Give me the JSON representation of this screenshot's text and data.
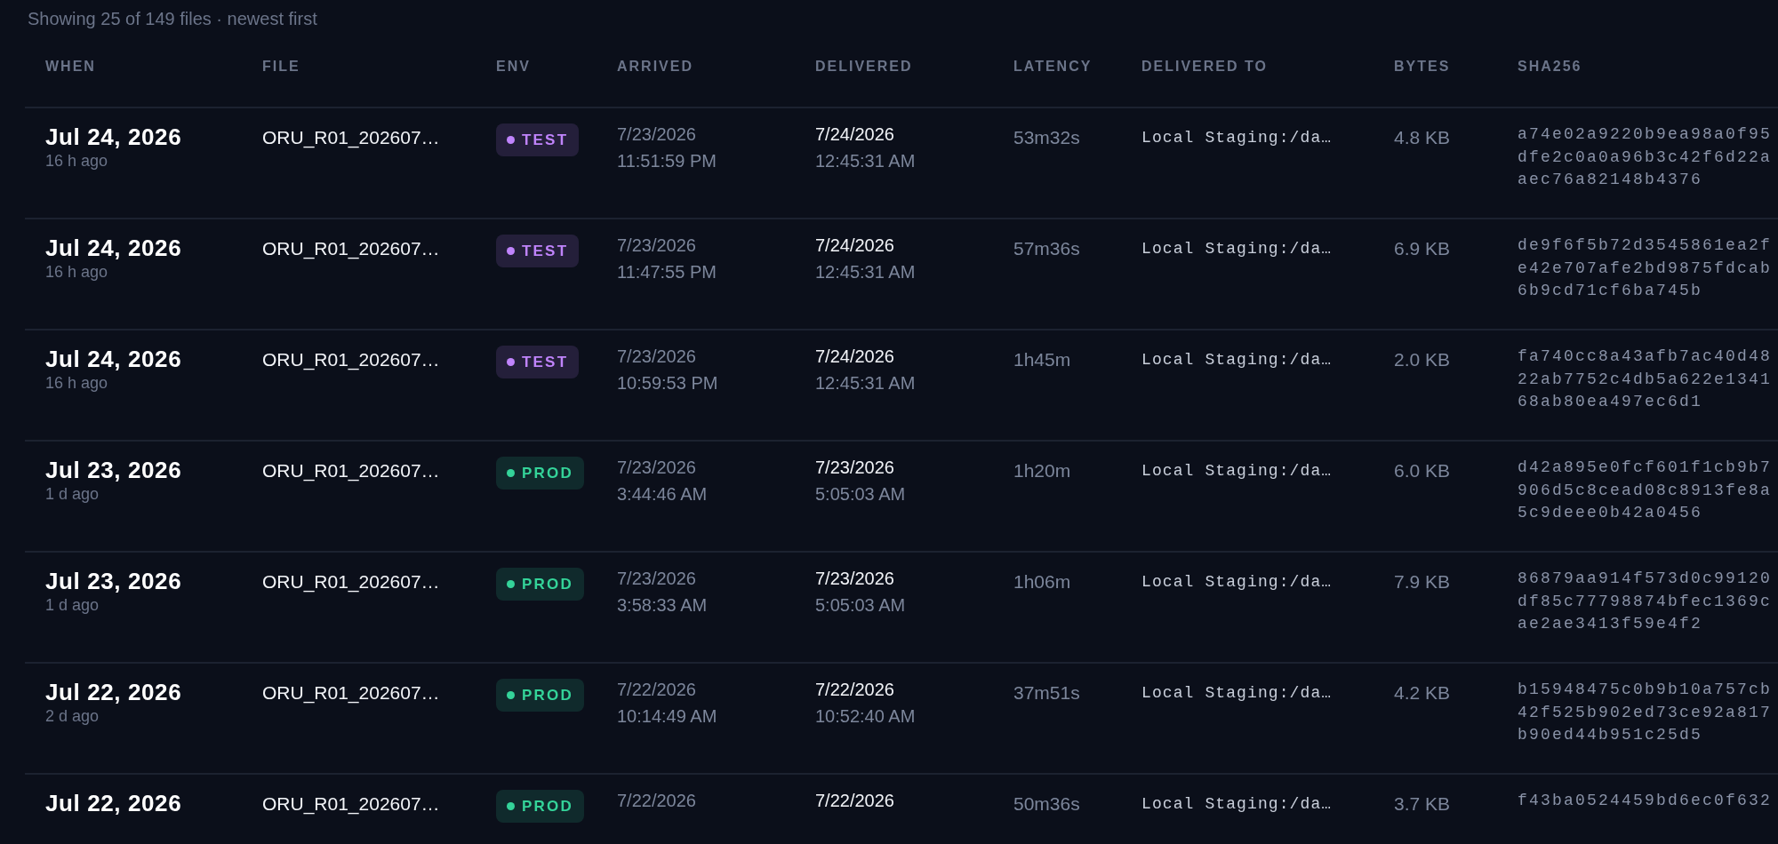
{
  "summary": "Showing 25 of 149 files · newest first",
  "columns": [
    "WHEN",
    "FILE",
    "ENV",
    "ARRIVED",
    "DELIVERED",
    "LATENCY",
    "DELIVERED TO",
    "BYTES",
    "SHA256"
  ],
  "rows": [
    {
      "when": "Jul 24, 2026",
      "ago": "16 h ago",
      "file": "ORU_R01_202607…",
      "env": {
        "label": "TEST",
        "color": "#c084fc"
      },
      "arrived": [
        "7/23/2026",
        "11:51:59 PM"
      ],
      "delivered": [
        "7/24/2026",
        "12:45:31 AM"
      ],
      "latency": "53m32s",
      "delivered_to": "Local Staging:/da…",
      "bytes": "4.8 KB",
      "sha256": [
        "a74e02a9220b9ea98a0f95",
        "dfe2c0a0a96b3c42f6d22a",
        "aec76a82148b4376"
      ]
    },
    {
      "when": "Jul 24, 2026",
      "ago": "16 h ago",
      "file": "ORU_R01_202607…",
      "env": {
        "label": "TEST",
        "color": "#c084fc"
      },
      "arrived": [
        "7/23/2026",
        "11:47:55 PM"
      ],
      "delivered": [
        "7/24/2026",
        "12:45:31 AM"
      ],
      "latency": "57m36s",
      "delivered_to": "Local Staging:/da…",
      "bytes": "6.9 KB",
      "sha256": [
        "de9f6f5b72d3545861ea2f",
        "e42e707afe2bd9875fdcab",
        "6b9cd71cf6ba745b"
      ]
    },
    {
      "when": "Jul 24, 2026",
      "ago": "16 h ago",
      "file": "ORU_R01_202607…",
      "env": {
        "label": "TEST",
        "color": "#c084fc"
      },
      "arrived": [
        "7/23/2026",
        "10:59:53 PM"
      ],
      "delivered": [
        "7/24/2026",
        "12:45:31 AM"
      ],
      "latency": "1h45m",
      "delivered_to": "Local Staging:/da…",
      "bytes": "2.0 KB",
      "sha256": [
        "fa740cc8a43afb7ac40d48",
        "22ab7752c4db5a622e1341",
        "68ab80ea497ec6d1"
      ]
    },
    {
      "when": "Jul 23, 2026",
      "ago": "1 d ago",
      "file": "ORU_R01_202607…",
      "env": {
        "label": "PROD",
        "color": "#34d399"
      },
      "arrived": [
        "7/23/2026",
        "3:44:46 AM"
      ],
      "delivered": [
        "7/23/2026",
        "5:05:03 AM"
      ],
      "latency": "1h20m",
      "delivered_to": "Local Staging:/da…",
      "bytes": "6.0 KB",
      "sha256": [
        "d42a895e0fcf601f1cb9b7",
        "906d5c8cead08c8913fe8a",
        "5c9deee0b42a0456"
      ]
    },
    {
      "when": "Jul 23, 2026",
      "ago": "1 d ago",
      "file": "ORU_R01_202607…",
      "env": {
        "label": "PROD",
        "color": "#34d399"
      },
      "arrived": [
        "7/23/2026",
        "3:58:33 AM"
      ],
      "delivered": [
        "7/23/2026",
        "5:05:03 AM"
      ],
      "latency": "1h06m",
      "delivered_to": "Local Staging:/da…",
      "bytes": "7.9 KB",
      "sha256": [
        "86879aa914f573d0c99120",
        "df85c77798874bfec1369c",
        "ae2ae3413f59e4f2"
      ]
    },
    {
      "when": "Jul 22, 2026",
      "ago": "2 d ago",
      "file": "ORU_R01_202607…",
      "env": {
        "label": "PROD",
        "color": "#34d399"
      },
      "arrived": [
        "7/22/2026",
        "10:14:49 AM"
      ],
      "delivered": [
        "7/22/2026",
        "10:52:40 AM"
      ],
      "latency": "37m51s",
      "delivered_to": "Local Staging:/da…",
      "bytes": "4.2 KB",
      "sha256": [
        "b15948475c0b9b10a757cb",
        "42f525b902ed73ce92a817",
        "b90ed44b951c25d5"
      ]
    },
    {
      "when": "Jul 22, 2026",
      "file": "ORU_R01_202607…",
      "env": {
        "label": "PROD",
        "color": "#34d399"
      },
      "arrived": [
        "7/22/2026"
      ],
      "delivered": [
        "7/22/2026"
      ],
      "latency": "50m36s",
      "delivered_to": "Local Staging:/da…",
      "bytes": "3.7 KB",
      "sha256": [
        "f43ba0524459bd6ec0f632"
      ]
    }
  ]
}
